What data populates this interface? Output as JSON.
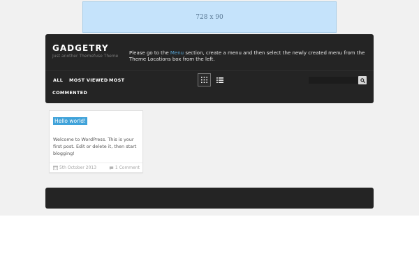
{
  "ad": {
    "label": "728 x 90"
  },
  "site": {
    "title": "GADGETRY",
    "tagline": "Just another Themefuse Theme"
  },
  "menu_notice": {
    "before": "Please go to the ",
    "link": "Menu",
    "after": " section, create a menu and then select the newly created menu from the Theme Locations box from the left."
  },
  "nav": {
    "items": [
      {
        "label": "ALL"
      },
      {
        "label": "MOST VIEWED"
      },
      {
        "label": "MOST"
      },
      {
        "label": "COMMENTED"
      }
    ]
  },
  "view_toggle": {
    "grid_icon": "grid-icon",
    "list_icon": "list-icon",
    "active": "grid"
  },
  "search": {
    "value": "",
    "placeholder": "",
    "icon": "search-icon"
  },
  "post": {
    "title": "Hello world!",
    "excerpt": "Welcome to WordPress. This is your first post. Edit or delete it, then start blogging!",
    "date": "5th October 2013",
    "comments": "1 Comment",
    "date_icon": "calendar-icon",
    "comment_icon": "comment-icon"
  },
  "colors": {
    "accent": "#3fa2d9",
    "header_bg": "#242424",
    "page_bg": "#f1f1f1",
    "ad_bg": "#c5e3fb"
  }
}
